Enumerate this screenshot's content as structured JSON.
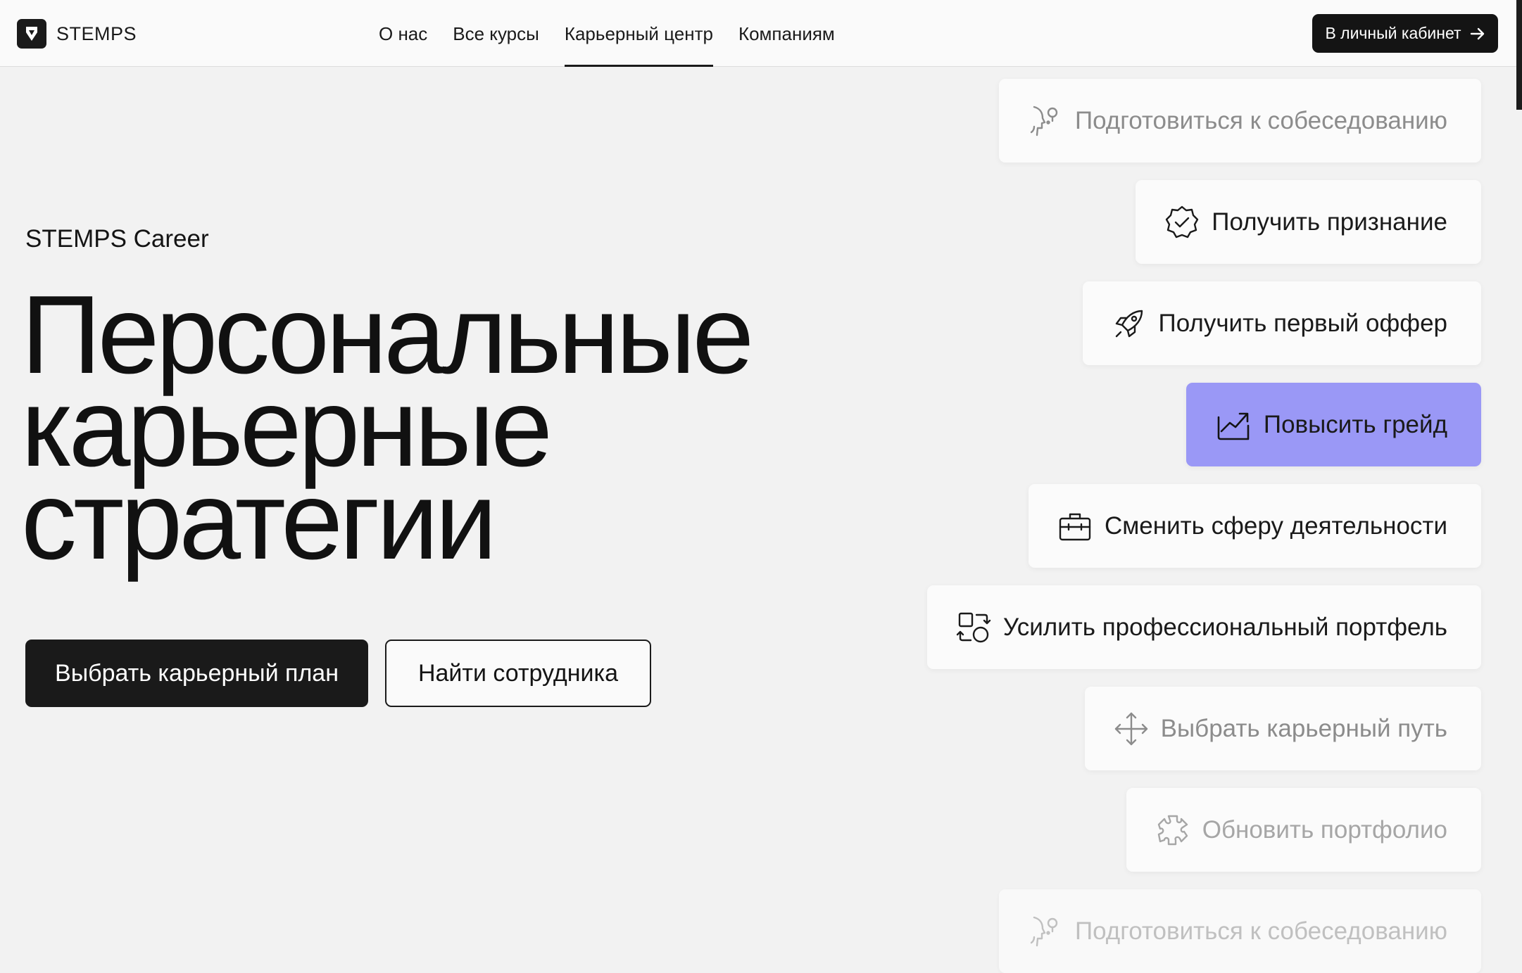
{
  "brand": {
    "name": "STEMPS"
  },
  "nav": {
    "items": [
      {
        "label": "О нас"
      },
      {
        "label": "Все курсы"
      },
      {
        "label": "Карьерный центр",
        "active": true
      },
      {
        "label": "Компаниям"
      }
    ]
  },
  "header": {
    "cabinet_label": "В личный кабинет"
  },
  "hero": {
    "subtitle": "STEMPS Career",
    "title_lines": [
      "Персональные",
      "карьерные",
      "стратегии"
    ],
    "primary_button": "Выбрать карьерный план",
    "secondary_button": "Найти сотрудника"
  },
  "goals": {
    "items": [
      {
        "label": "Подготовиться к собеседованию",
        "icon": "head-speech-icon"
      },
      {
        "label": "Получить признание",
        "icon": "verified-badge-icon"
      },
      {
        "label": "Получить первый оффер",
        "icon": "rocket-icon"
      },
      {
        "label": "Повысить грейд",
        "icon": "trend-up-icon",
        "active": true
      },
      {
        "label": "Сменить сферу деятельности",
        "icon": "briefcase-icon"
      },
      {
        "label": "Усилить профессиональный портфель",
        "icon": "swap-shapes-icon"
      },
      {
        "label": "Выбрать карьерный путь",
        "icon": "move-arrows-icon"
      },
      {
        "label": "Обновить портфолио",
        "icon": "puzzle-icon"
      },
      {
        "label": "Подготовиться к собеседованию",
        "icon": "head-speech-icon"
      }
    ]
  },
  "colors": {
    "accent": "#9a98f6",
    "dark": "#141414",
    "background": "#f2f2f2"
  }
}
